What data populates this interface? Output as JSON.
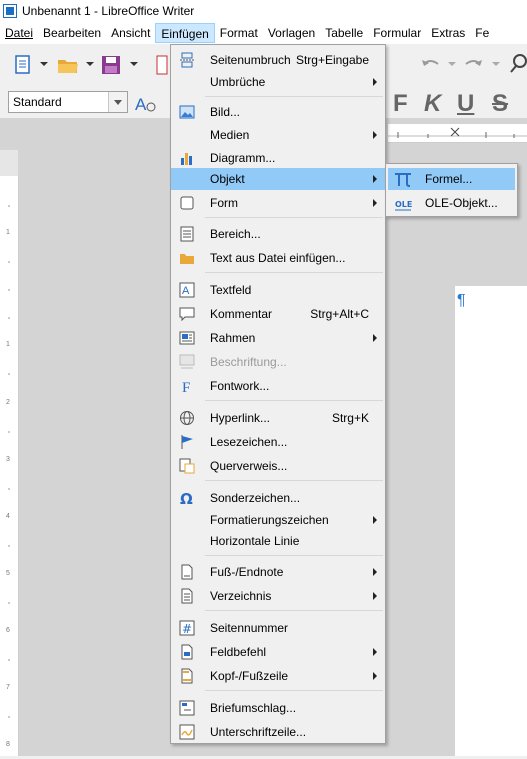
{
  "window": {
    "title": "Unbenannt 1 - LibreOffice Writer"
  },
  "menubar": [
    {
      "label": "Datei"
    },
    {
      "label": "Bearbeiten"
    },
    {
      "label": "Ansicht"
    },
    {
      "label": "Einfügen"
    },
    {
      "label": "Format"
    },
    {
      "label": "Vorlagen"
    },
    {
      "label": "Tabelle"
    },
    {
      "label": "Formular"
    },
    {
      "label": "Extras"
    },
    {
      "label": "Fe"
    }
  ],
  "toolbar": {
    "paragraph_style": "Standard",
    "bold_icon": "F",
    "italic_icon": "K",
    "underline_icon": "U",
    "strike_icon": "S"
  },
  "document": {
    "pilcrow": "¶"
  },
  "insert_menu": {
    "items": [
      {
        "label": "Seitenumbruch",
        "shortcut": "Strg+Eingabe",
        "icon": "page-break-icon"
      },
      {
        "label": "Umbrüche",
        "submenu": true
      },
      {
        "label": "Bild...",
        "icon": "image-icon"
      },
      {
        "label": "Medien",
        "submenu": true
      },
      {
        "label": "Diagramm...",
        "icon": "chart-icon"
      },
      {
        "label": "Objekt",
        "submenu": true
      },
      {
        "label": "Form",
        "submenu": true,
        "icon": "shape-icon"
      },
      {
        "label": "Bereich...",
        "icon": "section-icon"
      },
      {
        "label": "Text aus Datei einfügen...",
        "icon": "folder-icon"
      },
      {
        "label": "Textfeld",
        "icon": "textbox-icon"
      },
      {
        "label": "Kommentar",
        "shortcut": "Strg+Alt+C",
        "icon": "comment-icon"
      },
      {
        "label": "Rahmen",
        "submenu": true,
        "icon": "frame-icon"
      },
      {
        "label": "Beschriftung...",
        "disabled": true,
        "icon": "caption-icon"
      },
      {
        "label": "Fontwork...",
        "icon": "fontwork-icon"
      },
      {
        "label": "Hyperlink...",
        "shortcut": "Strg+K",
        "icon": "hyperlink-icon"
      },
      {
        "label": "Lesezeichen...",
        "icon": "bookmark-icon"
      },
      {
        "label": "Querverweis...",
        "icon": "crossref-icon"
      },
      {
        "label": "Sonderzeichen...",
        "icon": "omega-icon"
      },
      {
        "label": "Formatierungszeichen",
        "submenu": true
      },
      {
        "label": "Horizontale Linie"
      },
      {
        "label": "Fuß-/Endnote",
        "submenu": true,
        "icon": "footnote-icon"
      },
      {
        "label": "Verzeichnis",
        "submenu": true,
        "icon": "index-icon"
      },
      {
        "label": "Seitennummer",
        "icon": "hash-icon"
      },
      {
        "label": "Feldbefehl",
        "submenu": true,
        "icon": "field-icon"
      },
      {
        "label": "Kopf-/Fußzeile",
        "submenu": true,
        "icon": "header-footer-icon"
      },
      {
        "label": "Briefumschlag...",
        "icon": "envelope-icon"
      },
      {
        "label": "Unterschriftzeile...",
        "icon": "signature-icon"
      }
    ]
  },
  "object_submenu": {
    "items": [
      {
        "label": "Formel...",
        "icon": "pi-icon"
      },
      {
        "label": "OLE-Objekt...",
        "icon": "ole-icon"
      }
    ]
  },
  "colors": {
    "highlight": "#91c9f7",
    "menu_bg": "#f0f0f0",
    "menubar_active": "#cce8ff"
  }
}
